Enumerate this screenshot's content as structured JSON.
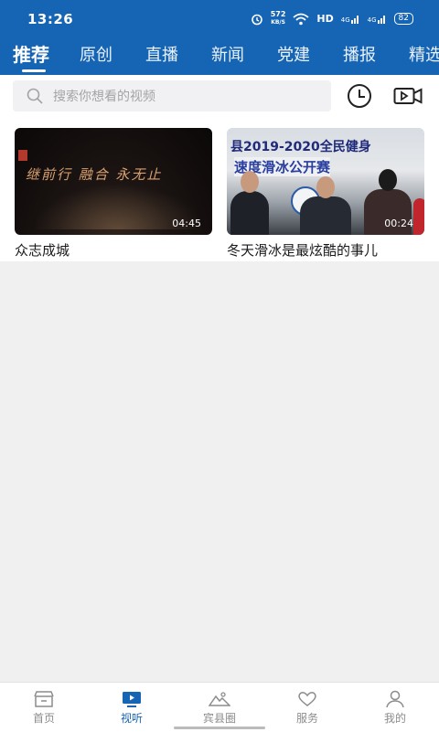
{
  "status_bar": {
    "time": "13:26",
    "net_speed": "572",
    "net_unit": "KB/S",
    "hd": "HD",
    "signal1": "4G",
    "signal2": "4G",
    "battery": "82"
  },
  "tabs": [
    {
      "label": "推荐",
      "active": true
    },
    {
      "label": "原创",
      "active": false
    },
    {
      "label": "直播",
      "active": false
    },
    {
      "label": "新闻",
      "active": false
    },
    {
      "label": "党建",
      "active": false
    },
    {
      "label": "播报",
      "active": false
    },
    {
      "label": "精选",
      "active": false
    }
  ],
  "search": {
    "placeholder": "搜索你想看的视频",
    "icon": "search-icon"
  },
  "toolbar_icons": [
    "history-clock-icon",
    "video-camera-icon"
  ],
  "videos": [
    {
      "title": "众志成城",
      "duration": "04:45",
      "thumb_text": "继前行  融合  永无止"
    },
    {
      "title": "冬天滑冰是最炫酷的事儿",
      "duration": "00:24",
      "thumb_text": "县2019-2020全民健身",
      "thumb_text2": "速度滑冰公开赛"
    }
  ],
  "bottom_nav": [
    {
      "label": "首页",
      "icon": "home-icon",
      "active": false
    },
    {
      "label": "视听",
      "icon": "tv-icon",
      "active": true
    },
    {
      "label": "宾县圈",
      "icon": "mountain-icon",
      "active": false
    },
    {
      "label": "服务",
      "icon": "heart-hand-icon",
      "active": false
    },
    {
      "label": "我的",
      "icon": "user-icon",
      "active": false
    }
  ],
  "colors": {
    "header": "#1664b4",
    "active_nav": "#1664b4",
    "page_bg": "#f0f0f0"
  }
}
